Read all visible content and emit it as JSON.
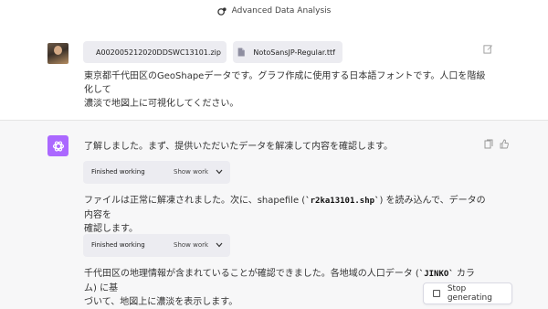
{
  "header": {
    "title": "Advanced Data Analysis",
    "icon": "advanced-data-analysis-icon"
  },
  "user_message": {
    "files": [
      {
        "name": "A002005212020DDSWC13101.zip",
        "icon": "file-icon"
      },
      {
        "name": "NotoSansJP-Regular.ttf",
        "icon": "file-icon"
      }
    ],
    "text_line1": "東京都千代田区のGeoShapeデータです。グラフ作成に使用する日本語フォントです。人口を階級化して",
    "text_line2": "濃淡で地図上に可視化してください。"
  },
  "assistant_message": {
    "p1": "了解しました。まず、提供いただいたデータを解凍して内容を確認します。",
    "work1": {
      "label": "Finished working",
      "toggle": "Show work"
    },
    "p2_line1_a": "ファイルは正常に解凍されました。次に、shapefile (",
    "p2_code": "`r2ka13101.shp`",
    "p2_line1_b": ") を読み込んで、データの内容を",
    "p2_line2": "確認します。",
    "work2": {
      "label": "Finished working",
      "toggle": "Show work"
    },
    "p3_line1_a": "千代田区の地理情報が含まれていることが確認できました。各地域の人口データ (",
    "p3_code": "`JINKO`",
    "p3_line1_b": " カラム) に基",
    "p3_line2": "づいて、地図上に濃淡を表示します。"
  },
  "controls": {
    "stop_label": "Stop generating"
  },
  "colors": {
    "assistant_avatar": "#ab68ff",
    "assistant_bg": "#f7f7f8",
    "chip_bg": "#ececf1"
  }
}
